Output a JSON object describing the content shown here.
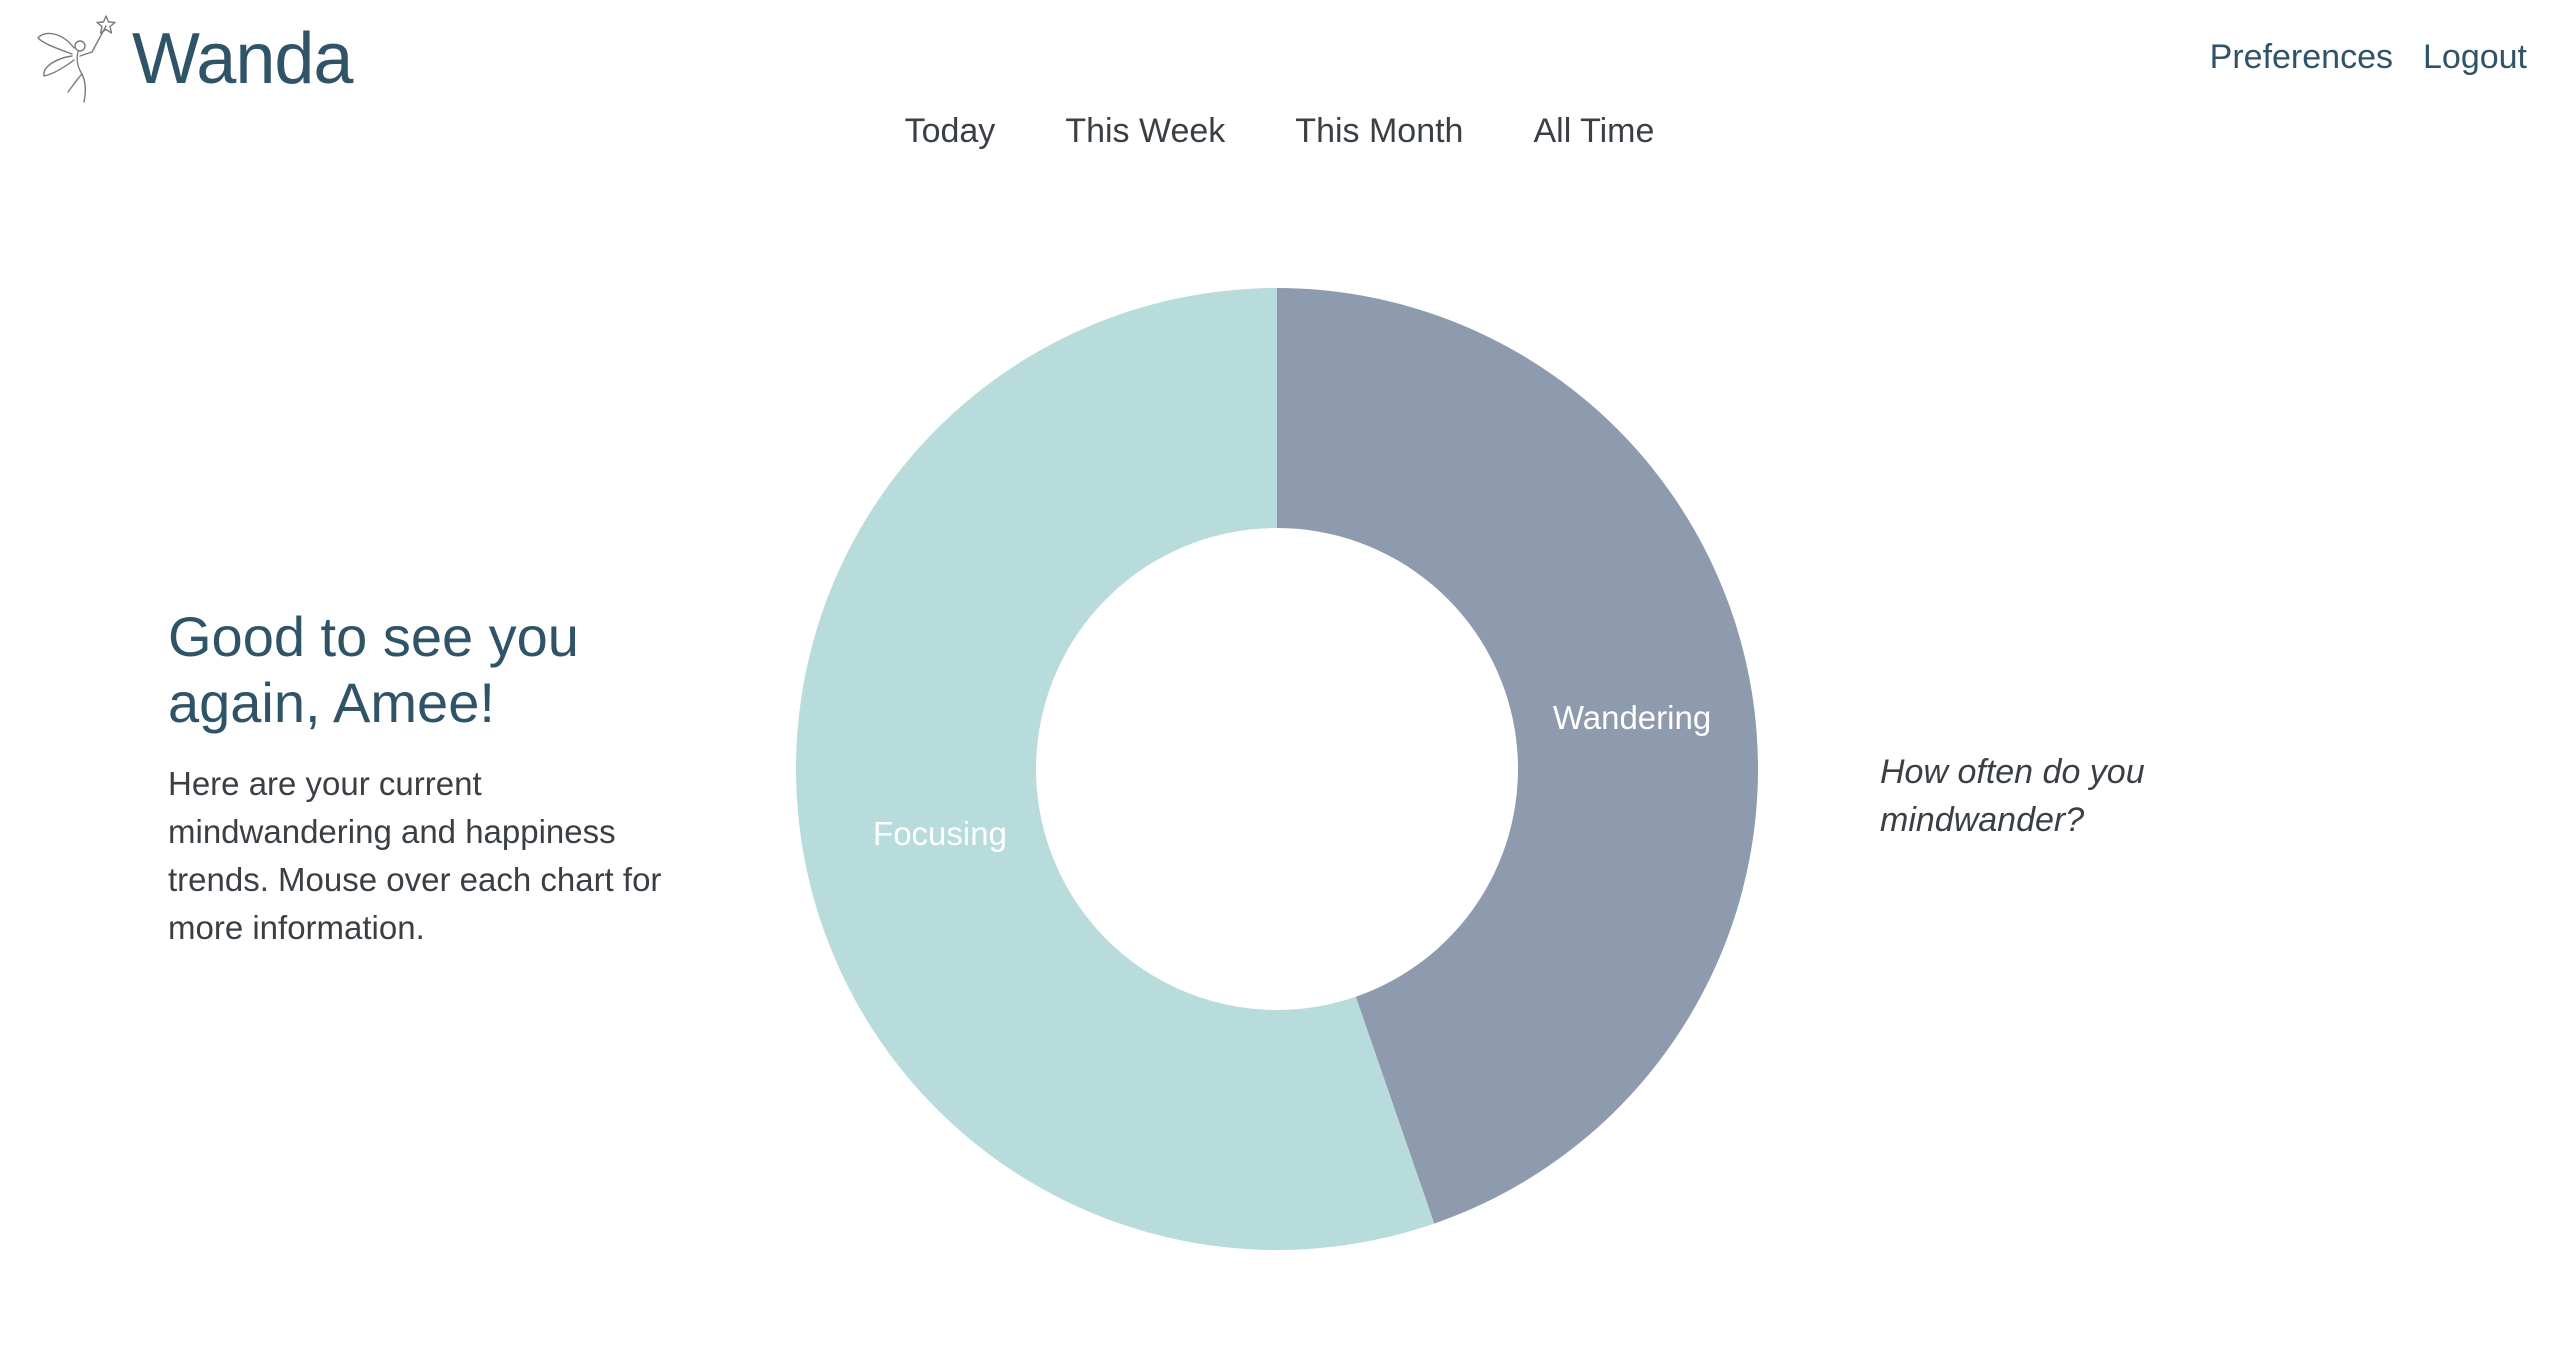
{
  "header": {
    "brand": "Wanda",
    "logo_icon": "fairy-icon",
    "links": [
      {
        "label": "Preferences"
      },
      {
        "label": "Logout"
      }
    ]
  },
  "tabs": [
    {
      "label": "Today"
    },
    {
      "label": "This Week"
    },
    {
      "label": "This Month"
    },
    {
      "label": "All Time"
    }
  ],
  "greeting": {
    "title_line1": "Good to see you",
    "title_line2": "again, Amee!",
    "text": "Here are your current mindwandering and happiness trends. Mouse over each chart for more information."
  },
  "question": {
    "line1": "How often do you",
    "line2": "mindwander?"
  },
  "colors": {
    "brand": "#2f5468",
    "wandering": "#8e9aad",
    "focusing": "#b8dbdb"
  },
  "chart_data": {
    "type": "pie",
    "variant": "donut",
    "labels": [
      "Wandering",
      "Focusing"
    ],
    "values": [
      0.447,
      0.553
    ],
    "colors": [
      "#8e9aad",
      "#b8dbdb"
    ]
  }
}
